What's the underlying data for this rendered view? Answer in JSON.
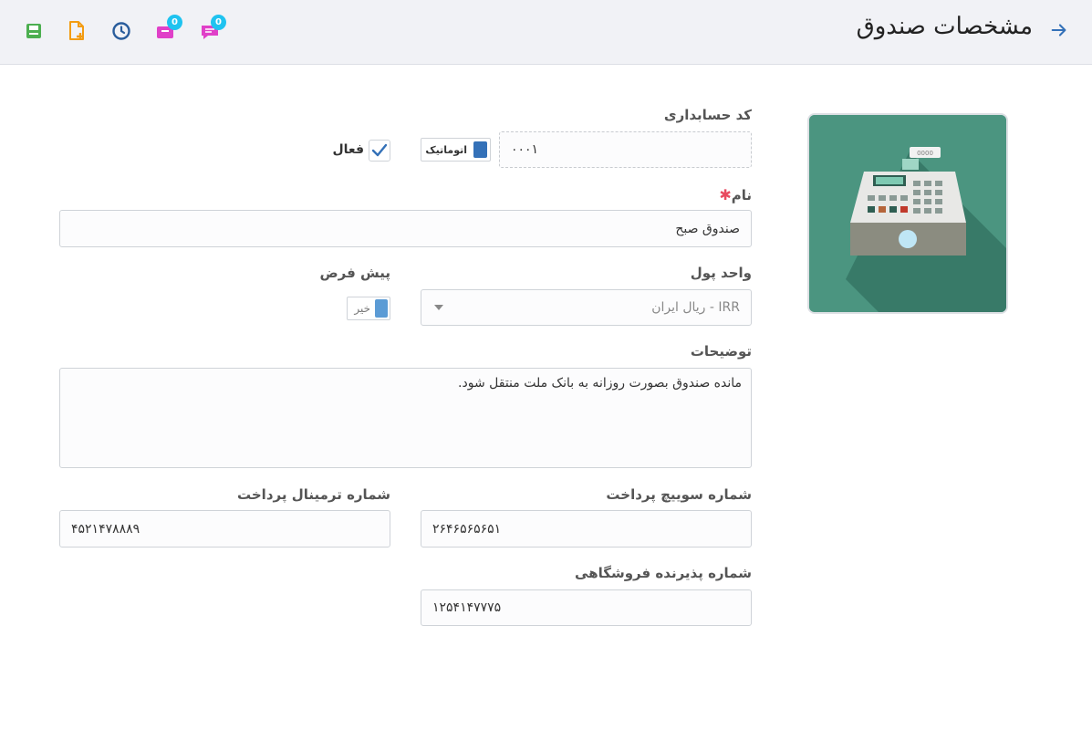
{
  "header": {
    "title": "مشخصات صندوق",
    "badges": {
      "inbox_count": "0",
      "chat_count": "0"
    }
  },
  "form": {
    "accounting_code": {
      "label": "کد حسابداری",
      "value": "۰۰۰۱"
    },
    "auto_toggle": {
      "label": "اتوماتیک"
    },
    "active": {
      "label": "فعال",
      "checked": true
    },
    "name": {
      "label": "نام",
      "value": "صندوق صبح"
    },
    "currency": {
      "label": "واحد پول",
      "value": "IRR - ریال ایران"
    },
    "default": {
      "label": "پیش فرض",
      "toggle_label": "خیر"
    },
    "description": {
      "label": "توضیحات",
      "value": "مانده صندوق بصورت روزانه به بانک ملت منتقل شود."
    },
    "switch_number": {
      "label": "شماره سوییچ پرداخت",
      "value": "۲۶۴۶۵۶۵۶۵۱"
    },
    "terminal_number": {
      "label": "شماره ترمینال پرداخت",
      "value": "۴۵۲۱۴۷۸۸۸۹"
    },
    "merchant_number": {
      "label": "شماره پذیرنده فروشگاهی",
      "value": "۱۲۵۴۱۴۷۷۷۵"
    }
  },
  "icons": {
    "back": "arrow-right-icon",
    "save": "save-icon",
    "new": "new-file-icon",
    "history": "clock-icon",
    "inbox": "inbox-icon",
    "chat": "chat-icon",
    "image": "cash-register-icon"
  },
  "colors": {
    "accent_blue": "#3471b8",
    "save_green": "#4caf50",
    "new_orange": "#f39c12",
    "magenta": "#e040c8",
    "badge": "#1fc3f0",
    "required": "#e84a5f",
    "image_bg": "#4b9580"
  }
}
